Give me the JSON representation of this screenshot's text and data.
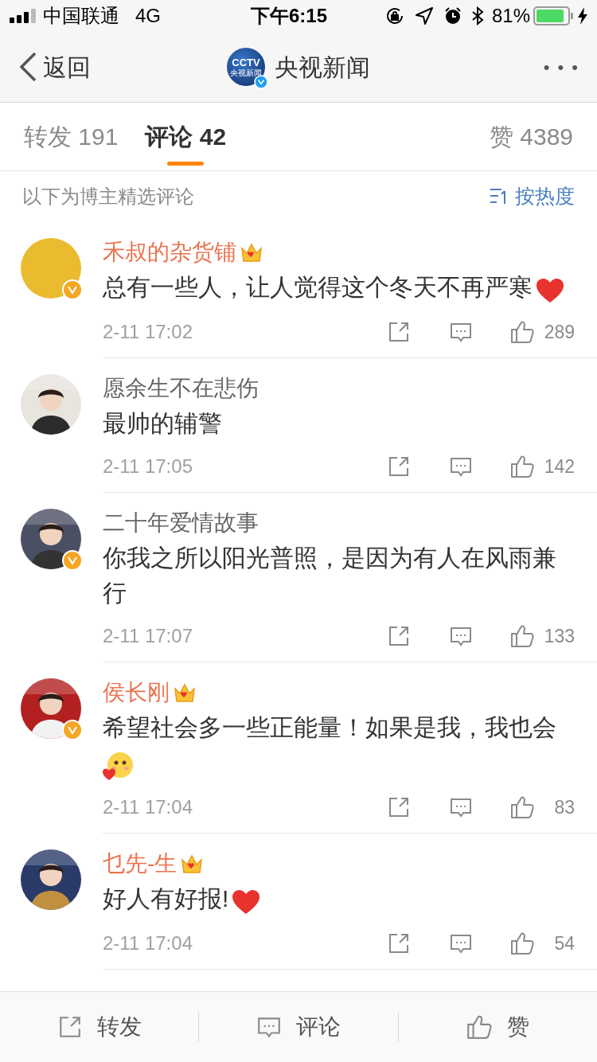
{
  "status_bar": {
    "carrier": "中国联通",
    "network": "4G",
    "time": "下午6:15",
    "battery": "81%"
  },
  "nav": {
    "back": "返回",
    "logo_top": "CCTV",
    "logo_bottom": "央视新闻",
    "title": "央视新闻",
    "verified": true,
    "more": "• • •"
  },
  "tabs": [
    {
      "label": "转发 191",
      "selected": false
    },
    {
      "label": "评论 42",
      "selected": true
    },
    {
      "label": "赞 4389",
      "selected": false
    }
  ],
  "list_header": {
    "note": "以下为博主精选评论",
    "sort": "按热度"
  },
  "comments": [
    {
      "avatar": {
        "kind": "color",
        "color": "#ebbb2f"
      },
      "verified": true,
      "vip": true,
      "name": "禾叔的杂货铺",
      "text": "总有一些人，让人觉得这个冬天不再严寒",
      "emoji": {
        "kind": "heart"
      },
      "time": "2-11 17:02",
      "likes": "289"
    },
    {
      "verified": false,
      "vip": false,
      "name": "愿余生不在悲伤",
      "text": "最帅的辅警",
      "time": "2-11 17:05",
      "likes": "142"
    },
    {
      "verified": true,
      "vip": false,
      "name": "二十年爱情故事",
      "text": "你我之所以阳光普照，是因为有人在风雨兼行",
      "time": "2-11 17:07",
      "likes": "133"
    },
    {
      "verified": true,
      "vip": true,
      "name": "侯长刚",
      "text": "希望社会多一些正能量！如果是我，我也会",
      "emoji": {
        "kind": "blush"
      },
      "time": "2-11 17:04",
      "likes": "83"
    },
    {
      "verified": false,
      "vip": true,
      "name": "乜先-生",
      "text": "好人有好报!",
      "emoji": {
        "kind": "heart"
      },
      "time": "2-11 17:04",
      "likes": "54"
    }
  ],
  "bottom_bar": [
    {
      "kind": "repost",
      "label": "转发"
    },
    {
      "kind": "comment",
      "label": "评论"
    },
    {
      "kind": "like",
      "label": "赞"
    }
  ]
}
